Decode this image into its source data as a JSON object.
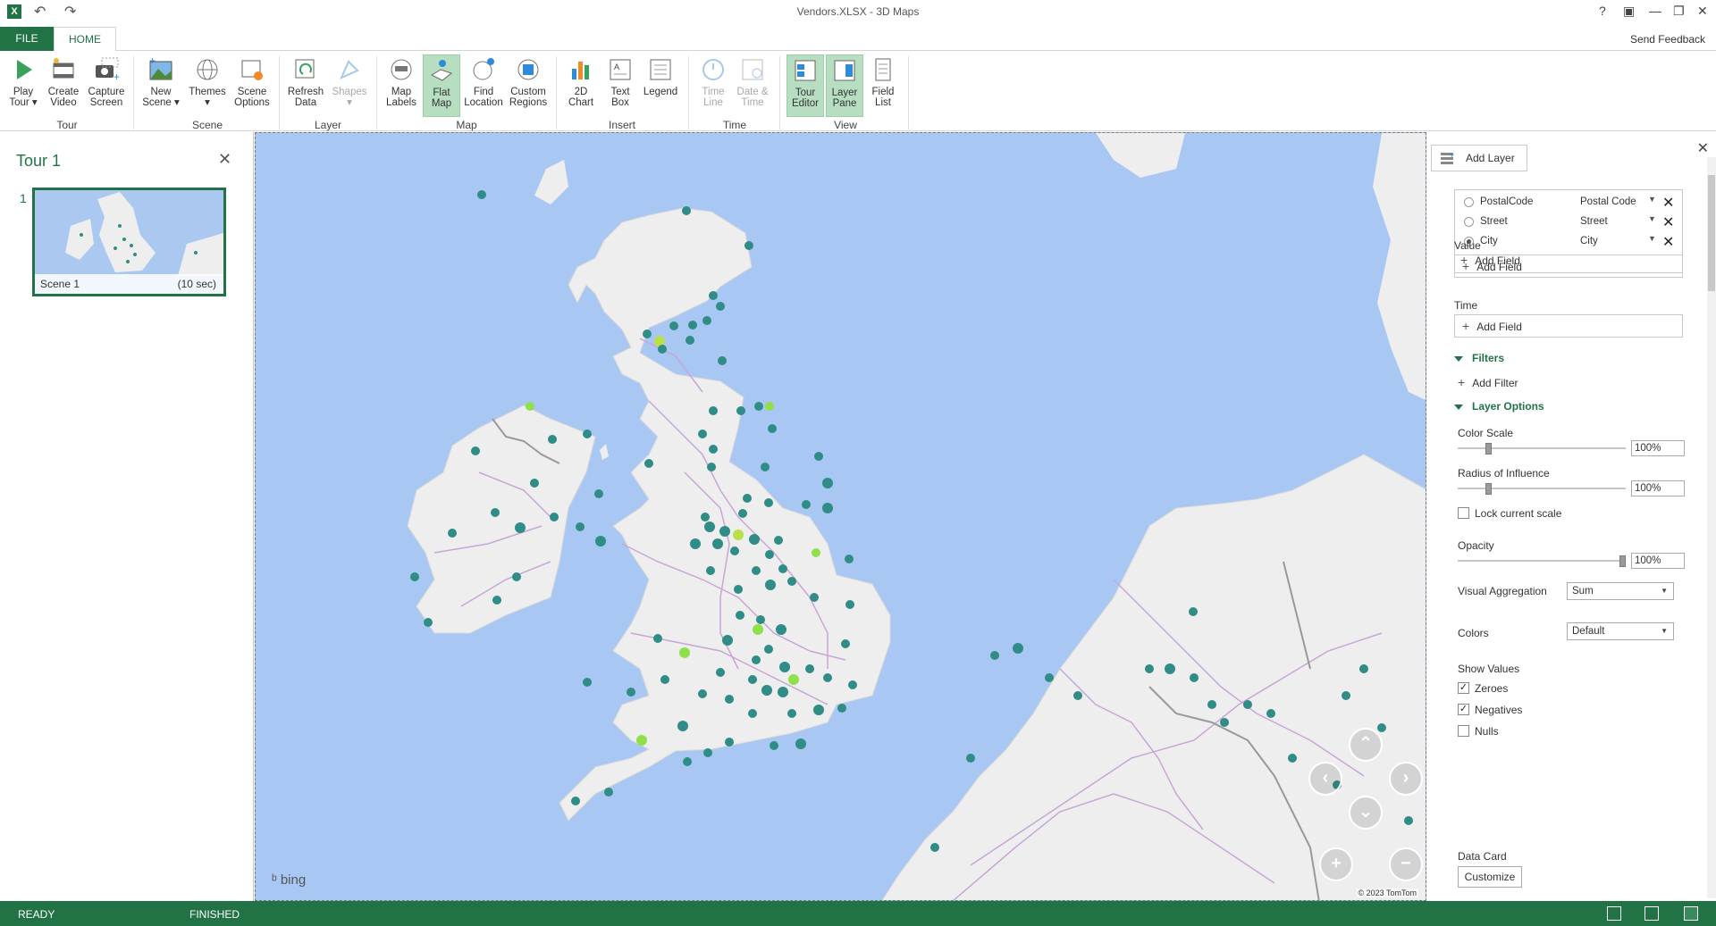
{
  "titlebar": {
    "title": "Vendors.XLSX - 3D Maps",
    "app_icon": "excel-icon",
    "help_glyph": "?"
  },
  "tabs": {
    "file": "FILE",
    "home": "HOME",
    "send_feedback": "Send Feedback"
  },
  "ribbon": {
    "groups": {
      "tour": "Tour",
      "scene": "Scene",
      "layer": "Layer",
      "map": "Map",
      "insert": "Insert",
      "time": "Time",
      "view": "View"
    },
    "buttons": {
      "play_tour": [
        "Play",
        "Tour"
      ],
      "create_video": [
        "Create",
        "Video"
      ],
      "capture_screen": [
        "Capture",
        "Screen"
      ],
      "new_scene": [
        "New",
        "Scene"
      ],
      "themes": [
        "Themes",
        ""
      ],
      "scene_options": [
        "Scene",
        "Options"
      ],
      "refresh_data": [
        "Refresh",
        "Data"
      ],
      "shapes": [
        "Shapes",
        ""
      ],
      "map_labels": [
        "Map",
        "Labels"
      ],
      "flat_map": [
        "Flat",
        "Map"
      ],
      "find_location": [
        "Find",
        "Location"
      ],
      "custom_regions": [
        "Custom",
        "Regions"
      ],
      "chart_2d": [
        "2D",
        "Chart"
      ],
      "text_box": [
        "Text",
        "Box"
      ],
      "legend": [
        "Legend",
        ""
      ],
      "time_line": [
        "Time",
        "Line"
      ],
      "date_time": [
        "Date &",
        "Time"
      ],
      "tour_editor": [
        "Tour",
        "Editor"
      ],
      "layer_pane": [
        "Layer",
        "Pane"
      ],
      "field_list": [
        "Field",
        "List"
      ]
    }
  },
  "tour": {
    "title": "Tour 1",
    "scene_number": "1",
    "scene_name": "Scene 1",
    "scene_duration": "(10 sec)"
  },
  "map": {
    "attribution": "bing",
    "copyright": "© 2023 TomTom",
    "nav": {
      "up": "⌃",
      "left": "‹",
      "right": "›",
      "down": "⌄",
      "zoom_in": "+",
      "zoom_out": "−"
    }
  },
  "layer_pane": {
    "add_layer": "Add Layer",
    "geography": [
      {
        "field": "PostalCode",
        "type": "Postal Code",
        "selected": false
      },
      {
        "field": "Street",
        "type": "Street",
        "selected": false
      },
      {
        "field": "City",
        "type": "City",
        "selected": true
      }
    ],
    "add_field": "Add Field",
    "value_label": "Value",
    "time_label": "Time",
    "filters_label": "Filters",
    "add_filter": "Add Filter",
    "layer_options_label": "Layer Options",
    "color_scale": {
      "label": "Color Scale",
      "value": "100%",
      "level": 0.17
    },
    "radius": {
      "label": "Radius of Influence",
      "value": "100%",
      "level": 0.17
    },
    "lock_scale": "Lock current scale",
    "opacity": {
      "label": "Opacity",
      "value": "100%",
      "level": 1.0
    },
    "visual_aggregation": {
      "label": "Visual Aggregation",
      "value": "Sum"
    },
    "colors": {
      "label": "Colors",
      "value": "Default"
    },
    "show_values": {
      "label": "Show Values",
      "zeroes": "Zeroes",
      "zeroes_checked": true,
      "negatives": "Negatives",
      "negatives_checked": true,
      "nulls": "Nulls",
      "nulls_checked": false
    },
    "data_card": {
      "label": "Data Card",
      "button": "Customize"
    }
  },
  "statusbar": {
    "ready": "READY",
    "finished": "FINISHED"
  },
  "colors": {
    "accent": "#217346",
    "water": "#a9c7f3",
    "land": "#eeeeee",
    "point": "#2f8c86",
    "point_hot": "#8fe04a"
  }
}
